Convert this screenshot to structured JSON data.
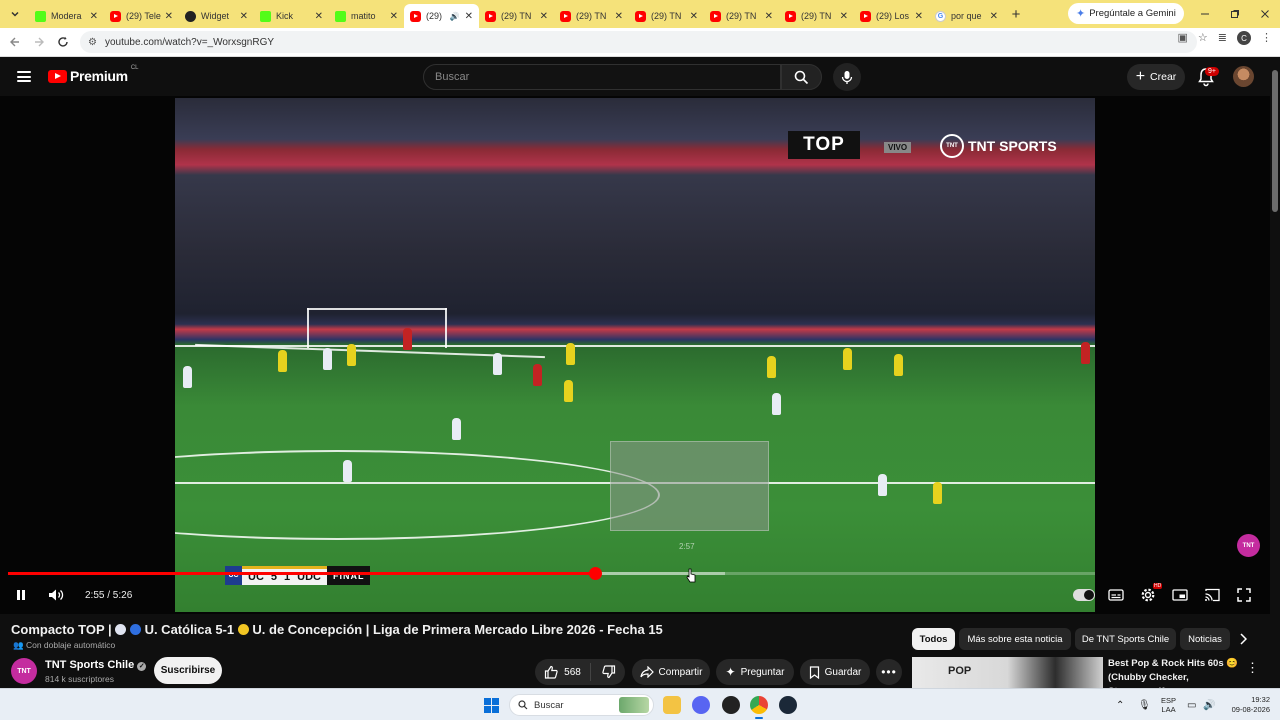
{
  "browser": {
    "tabs": [
      {
        "label": "Modera",
        "icon": "kick"
      },
      {
        "label": "(29) Tele",
        "icon": "yt"
      },
      {
        "label": "Widget",
        "icon": "shield"
      },
      {
        "label": "Kick",
        "icon": "kick"
      },
      {
        "label": "matito",
        "icon": "kick"
      },
      {
        "label": "(29)",
        "icon": "yt",
        "active": true,
        "audio": true
      },
      {
        "label": "(29) TN",
        "icon": "yt"
      },
      {
        "label": "(29) TN",
        "icon": "yt"
      },
      {
        "label": "(29) TN",
        "icon": "yt"
      },
      {
        "label": "(29) TN",
        "icon": "yt"
      },
      {
        "label": "(29) TN",
        "icon": "yt"
      },
      {
        "label": "(29) Los",
        "icon": "yt"
      },
      {
        "label": "por que",
        "icon": "google"
      }
    ],
    "gemini_label": "Pregúntale a Gemini",
    "url": "youtube.com/watch?v=_WorxsgnRGY",
    "profile_initial": "C"
  },
  "masthead": {
    "brand": "Premium",
    "region": "CL",
    "search_placeholder": "Buscar",
    "create_label": "Crear",
    "notifications_badge": "9+"
  },
  "player": {
    "overlay_top": "TOP",
    "overlay_vivo": "VIVO",
    "overlay_tnt": "TNT SPORTS",
    "watermark": "TNT",
    "preview_time": "2:57",
    "scorebug": {
      "home": "UC",
      "home_score": "5",
      "away_score": "1",
      "away": "UDC",
      "status": "FINAL"
    },
    "current_time": "2:55",
    "duration": "5:26",
    "time_display": "2:55 / 5:26",
    "progress_fraction": 0.54,
    "buffer_fraction": 0.66
  },
  "video": {
    "title_a": "Compacto TOP |",
    "title_b": "U. Católica 5-1",
    "title_c": "U. de Concepción | Liga de Primera Mercado Libre 2026 - Fecha 15",
    "dub_note": "Con doblaje automático",
    "channel_name": "TNT Sports Chile",
    "channel_avatar": "TNT",
    "subscribers": "814 k suscriptores",
    "subscribe_label": "Suscribirse",
    "likes": "568",
    "share_label": "Compartir",
    "ask_label": "Preguntar",
    "save_label": "Guardar"
  },
  "chips": [
    "Todos",
    "Más sobre esta noticia",
    "De TNT Sports Chile",
    "Noticias"
  ],
  "recommendation": {
    "thumb_text": "POP",
    "title": "Best Pop & Rock Hits 60s 😊 (Chubby Checker, Steppenwolf..."
  },
  "taskbar": {
    "search_label": "Buscar",
    "lang_top": "ESP",
    "lang_bottom": "LAA",
    "time": "19:32",
    "date": "09-08-2026",
    "icons": [
      "file-explorer",
      "discord",
      "app-dark",
      "chrome",
      "steam"
    ]
  },
  "colors": {
    "accent": "#ff0000",
    "tab_strip": "#f5e27a",
    "background": "#0f0f0f"
  }
}
